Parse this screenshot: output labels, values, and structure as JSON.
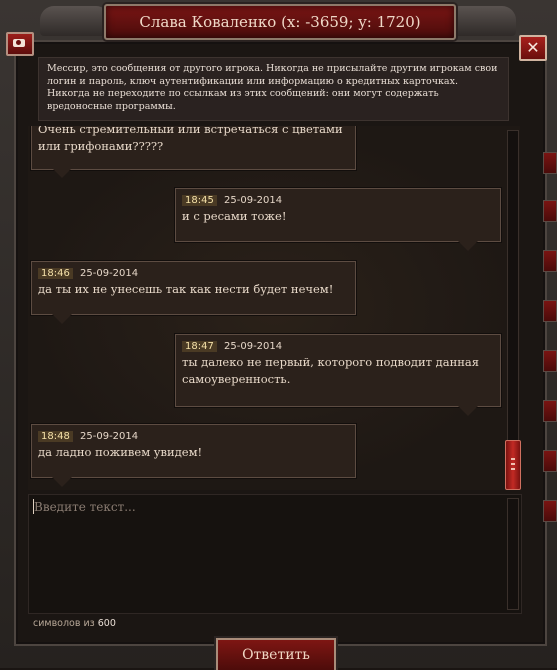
{
  "window": {
    "title": "Слава Коваленко (x: -3659; y: 1720)"
  },
  "warning": "Мессир, это сообщения от другого игрока. Никогда не присылайте другим игрокам свои логин и пароль, ключ аутентификации или информацию о кредитных карточках. Никогда не переходите по ссылкам из этих сообщений: они могут содержать вредоносные программы.",
  "messages": [
    {
      "time": "",
      "date": "",
      "text": "Очень стремительный или встречаться с цветами или грифонами?????"
    },
    {
      "time": "18:45",
      "date": "25-09-2014",
      "text": "и с ресами тоже!"
    },
    {
      "time": "18:46",
      "date": "25-09-2014",
      "text": "да ты их не унесешь так как нести будет нечем!"
    },
    {
      "time": "18:47",
      "date": "25-09-2014",
      "text": "ты далеко не первый, которого подводит данная самоуверенность."
    },
    {
      "time": "18:48",
      "date": "25-09-2014",
      "text": "да ладно поживем увидем!"
    }
  ],
  "input": {
    "placeholder": "Введите текст..."
  },
  "counter": {
    "label": "символов из",
    "max": "600"
  },
  "reply_button": "Ответить",
  "colors": {
    "accent": "#7e1613",
    "timestamp_bg": "#4a3a24"
  }
}
